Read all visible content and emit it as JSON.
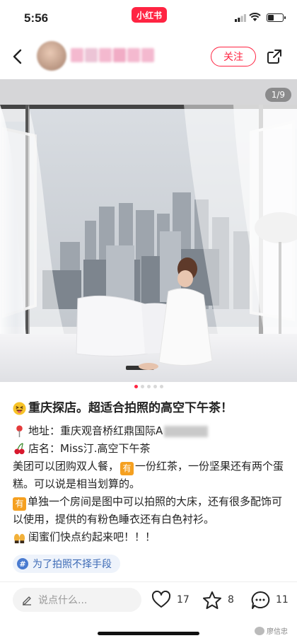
{
  "status_bar": {
    "time": "5:56",
    "app_badge": "小红书"
  },
  "header": {
    "follow_label": "关注"
  },
  "post": {
    "image_counter": "1/9",
    "title": "重庆探店。超适合拍照的高空下午茶！",
    "address_label": "地址：重庆观音桥红鼎国际A",
    "shop_label": "店名：Miss汀.高空下午茶",
    "line1_a": "美团可以团购双人餐，",
    "you_badge": "有",
    "line1_b": "一份红茶，一份坚果还有两个蛋糕。可以说是相当划算的。",
    "line2": "单独一个房间是图中可以拍照的大床，还有很多配饰可以使用，提供的有粉色睡衣还有白色衬衫。",
    "line3": "闺蜜们快点约起来吧！！！",
    "hashtag": "为了拍照不择手段",
    "hashtag_icon": "#"
  },
  "bottom_bar": {
    "comment_placeholder": "说点什么...",
    "likes": "17",
    "collects": "8",
    "comments": "11"
  },
  "watermark": "廖信忠",
  "colors": {
    "brand": "#ff2442",
    "tag_text": "#3c6ab5",
    "badge_orange": "#f5a020"
  },
  "icons": [
    "back-arrow-icon",
    "share-icon",
    "heart-icon",
    "star-icon",
    "comment-icon",
    "pen-icon",
    "pin-icon",
    "cherry-icon",
    "grin-emoji-icon",
    "clap-emoji-icon",
    "wifi-icon",
    "signal-icon",
    "battery-icon"
  ]
}
